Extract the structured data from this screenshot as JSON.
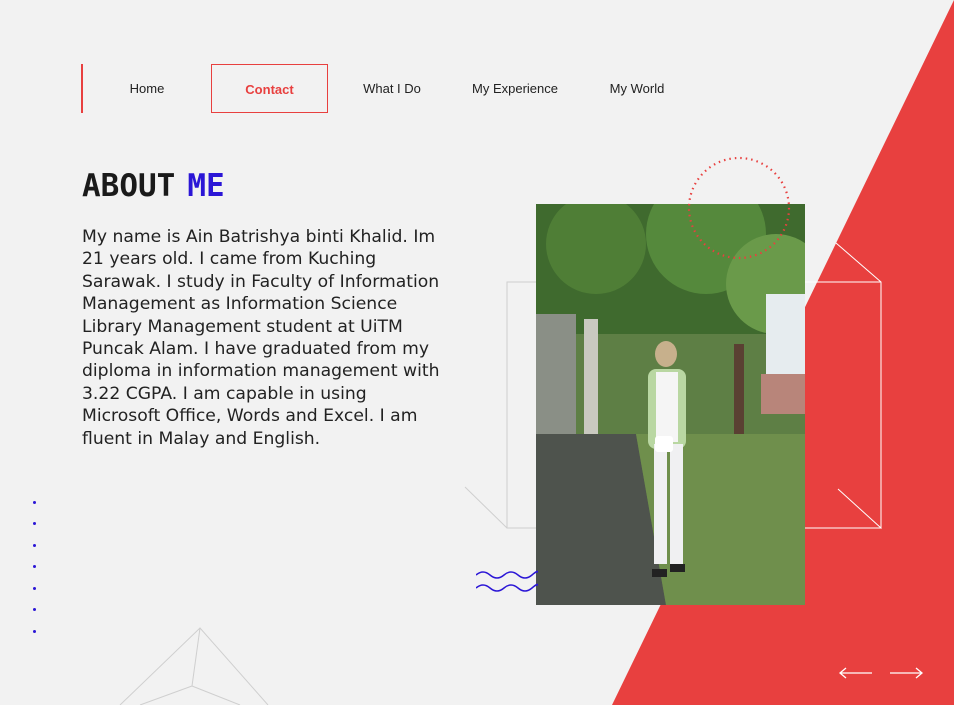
{
  "nav": {
    "items": [
      {
        "label": "Home",
        "active": false
      },
      {
        "label": "Contact",
        "active": true
      },
      {
        "label": "What I Do",
        "active": false
      },
      {
        "label": "My Experience",
        "active": false
      },
      {
        "label": "My World",
        "active": false
      }
    ]
  },
  "about": {
    "title_word1": "ABOUT",
    "title_word2": "ME",
    "bio": "My name is Ain Batrishya binti Khalid. Im 21 years old. I came from Kuching Sarawak. I study in Faculty of Information Management as Information Science Library Management student at UiTM Puncak Alam. I have graduated from my diploma in information management with 3.22 CGPA. I am capable in using Microsoft Office, Words and Excel. I am fluent in Malay and English."
  },
  "photo": {
    "icon": "portrait-photo-icon"
  },
  "controls": {
    "prev_icon": "arrow-left-icon",
    "next_icon": "arrow-right-icon"
  },
  "colors": {
    "accent_red": "#e8403f",
    "accent_blue": "#2b16d6",
    "background": "#f2f2f2"
  }
}
